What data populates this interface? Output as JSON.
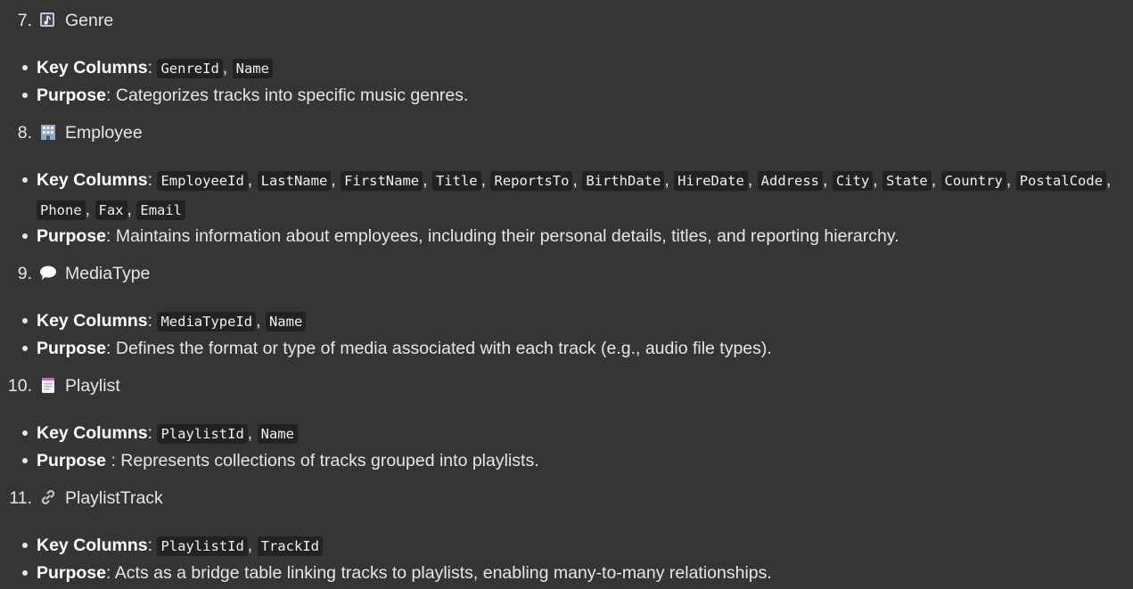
{
  "sections": [
    {
      "number": "7.",
      "icon": "music-score-icon",
      "title": "Genre",
      "key_label": "Key Columns",
      "columns": [
        "GenreId",
        "Name"
      ],
      "purpose_label": "Purpose",
      "purpose_sep": ":",
      "purpose_text": " Categorizes tracks into specific music genres."
    },
    {
      "number": "8.",
      "icon": "office-building-icon",
      "title": "Employee",
      "key_label": "Key Columns",
      "columns": [
        "EmployeeId",
        "LastName",
        "FirstName",
        "Title",
        "ReportsTo",
        "BirthDate",
        "HireDate",
        "Address",
        "City",
        "State",
        "Country",
        "PostalCode",
        "Phone",
        "Fax",
        "Email"
      ],
      "purpose_label": "Purpose",
      "purpose_sep": ":",
      "purpose_text": " Maintains information about employees, including their personal details, titles, and reporting hierarchy."
    },
    {
      "number": "9.",
      "icon": "speech-bubble-icon",
      "title": "MediaType",
      "key_label": "Key Columns",
      "columns": [
        "MediaTypeId",
        "Name"
      ],
      "purpose_label": "Purpose",
      "purpose_sep": ":",
      "purpose_text": " Defines the format or type of media associated with each track (e.g., audio file types)."
    },
    {
      "number": "10.",
      "icon": "notepad-icon",
      "title": "Playlist",
      "key_label": "Key Columns",
      "columns": [
        "PlaylistId",
        "Name"
      ],
      "purpose_label": "Purpose",
      "purpose_sep": " :",
      "purpose_text": " Represents collections of tracks grouped into playlists."
    },
    {
      "number": "11.",
      "icon": "link-icon",
      "title": "PlaylistTrack",
      "key_label": "Key Columns",
      "columns": [
        "PlaylistId",
        "TrackId"
      ],
      "purpose_label": "Purpose",
      "purpose_sep": ":",
      "purpose_text": " Acts as a bridge table linking tracks to playlists, enabling many-to-many relationships."
    }
  ]
}
